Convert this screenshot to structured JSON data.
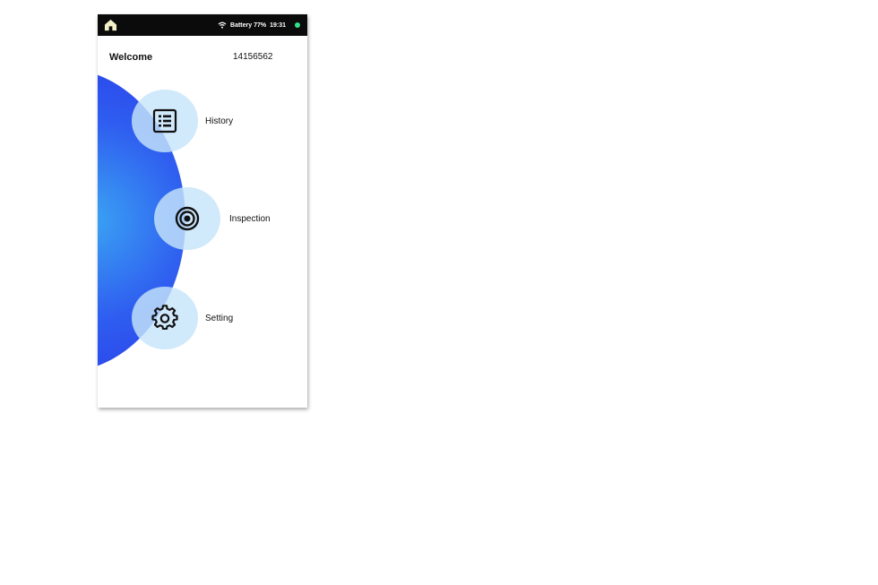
{
  "status_bar": {
    "battery_label": "Battery 77%",
    "time": "19:31",
    "icons": [
      "home-icon",
      "wifi-icon",
      "status-dot-icon"
    ],
    "indicator_color": "#33e08a"
  },
  "header": {
    "welcome": "Welcome",
    "user_id": "14156562"
  },
  "menu": {
    "items": [
      {
        "label": "History",
        "icon": "list-icon"
      },
      {
        "label": "Inspection",
        "icon": "target-icon"
      },
      {
        "label": "Setting",
        "icon": "gear-icon"
      }
    ]
  },
  "colors": {
    "accent_dark": "#2733e6",
    "accent_light": "#3aa3f3",
    "circle_fill": "#c6e4fa"
  }
}
